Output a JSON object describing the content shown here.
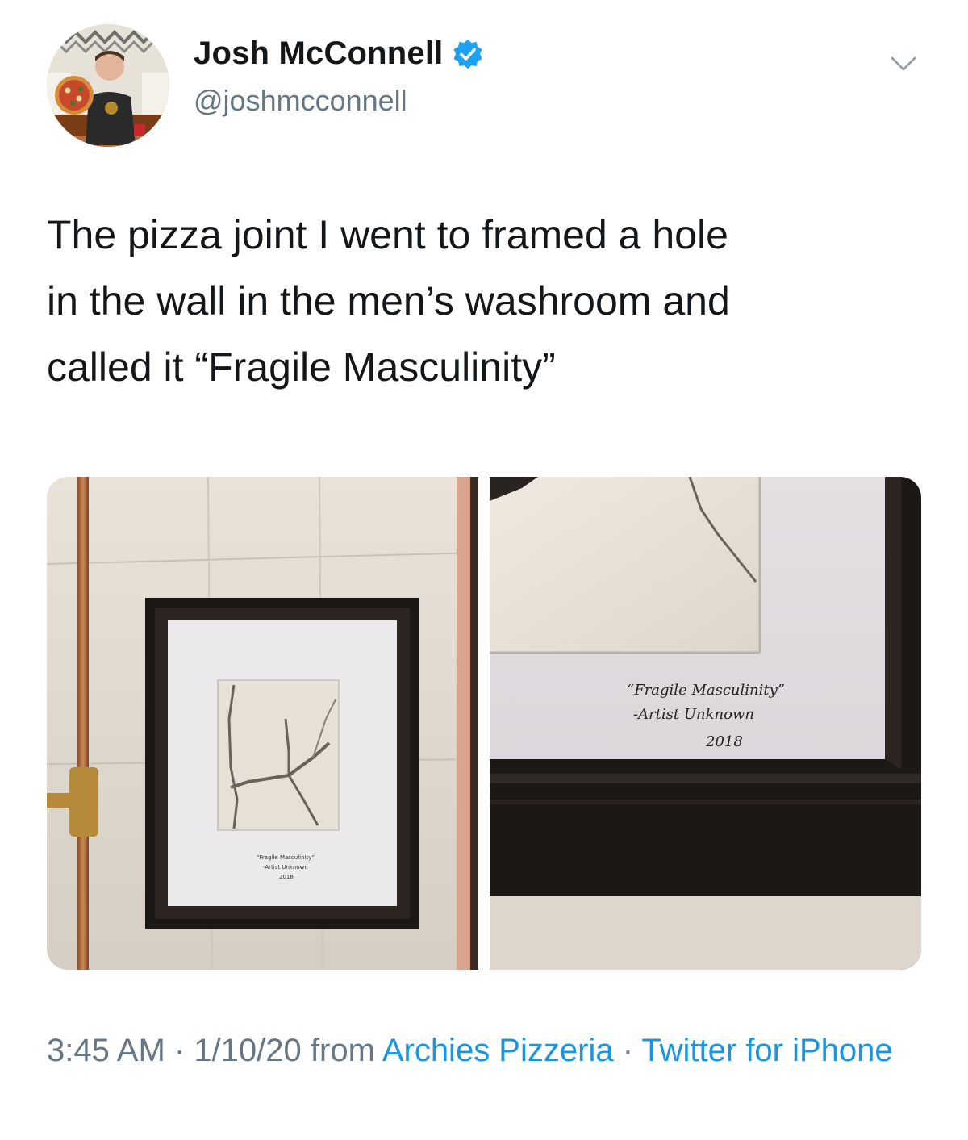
{
  "author": {
    "display_name": "Josh McConnell",
    "handle": "@joshmcconnell",
    "verified": true
  },
  "tweet": {
    "text": "The pizza joint I went to framed a hole\nin the wall in the men’s washroom and\ncalled it “Fragile Masculinity”"
  },
  "media": {
    "photo_1": {
      "caption_line_1": "“Fragile Masculinity”",
      "caption_line_2": "-Artist Unknown",
      "caption_line_3": "2018"
    },
    "photo_2": {
      "caption_line_1": "“Fragile Masculinity”",
      "caption_line_2": "-Artist Unknown",
      "caption_line_3": "2018"
    }
  },
  "meta": {
    "time": "3:45 AM",
    "separator": " · ",
    "date": "1/10/20",
    "from_word": " from ",
    "location": "Archies Pizzeria",
    "client": "Twitter for iPhone"
  },
  "colors": {
    "text_primary": "#14171a",
    "text_secondary": "#657786",
    "link": "#1b95e0",
    "verified_badge": "#1da1f2"
  },
  "icons": {
    "verified": "verified-badge-icon",
    "more": "chevron-down-icon"
  }
}
